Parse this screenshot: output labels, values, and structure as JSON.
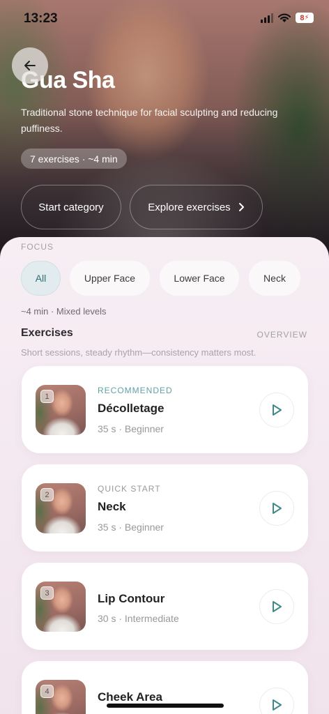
{
  "status": {
    "time": "13:23",
    "battery": "8"
  },
  "hero": {
    "title": "Gua Sha",
    "description": "Traditional stone technique for facial sculpting and reducing puffiness.",
    "meta": "7 exercises · ~4 min",
    "start_label": "Start category",
    "explore_label": "Explore exercises"
  },
  "focus": {
    "label": "FOCUS",
    "chips": [
      "All",
      "Upper Face",
      "Lower Face",
      "Neck"
    ],
    "summary": "~4 min · Mixed levels"
  },
  "exercises": {
    "title": "Exercises",
    "overview_label": "OVERVIEW",
    "subtitle": "Short sessions, steady rhythm—consistency matters most.",
    "items": [
      {
        "number": "1",
        "tag": "RECOMMENDED",
        "name": "Décolletage",
        "meta": "35 s · Beginner"
      },
      {
        "number": "2",
        "tag": "QUICK START",
        "name": "Neck",
        "meta": "35 s · Beginner"
      },
      {
        "number": "3",
        "tag": "",
        "name": "Lip Contour",
        "meta": "30 s · Intermediate"
      },
      {
        "number": "4",
        "tag": "",
        "name": "Cheek Area",
        "meta": ""
      }
    ]
  },
  "colors": {
    "accent": "#2e6e73",
    "recommended_tag": "#5fa2a6",
    "quickstart_tag": "#9b979e",
    "play": "#3d8a86"
  }
}
